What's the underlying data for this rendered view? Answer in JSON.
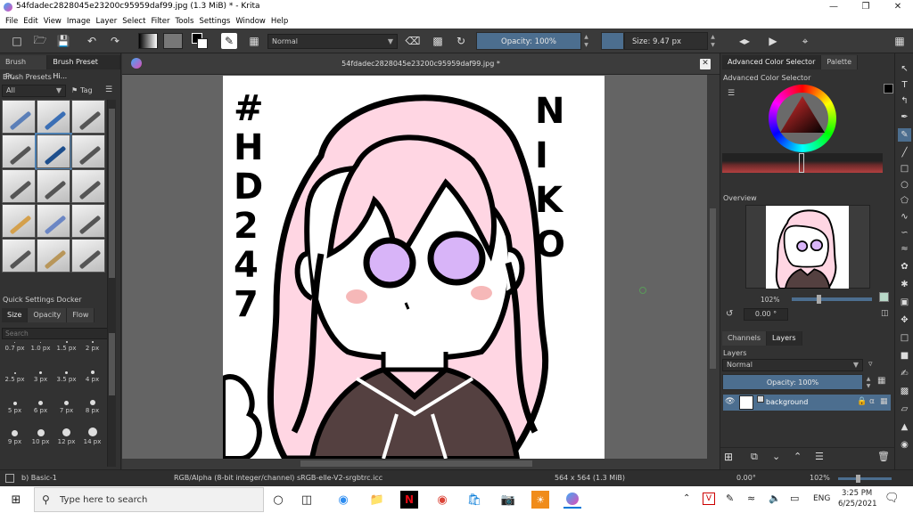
{
  "window": {
    "title": "54fdadec2828045e23200c95959daf99.jpg (1.3 MiB)  * - Krita"
  },
  "menu": [
    "File",
    "Edit",
    "View",
    "Image",
    "Layer",
    "Select",
    "Filter",
    "Tools",
    "Settings",
    "Window",
    "Help"
  ],
  "toolbar": {
    "blend_mode": "Normal",
    "opacity_label": "Opacity: 100%",
    "size_label": "Size: 9.47 px"
  },
  "left_panel": {
    "tab1": "Brush Pr...",
    "tab2": "Brush Preset Hi...",
    "brush_presets_title": "Brush Presets",
    "filter_value": "All",
    "tag_label": "Tag",
    "search_placeholder": "Search",
    "quick_settings_title": "Quick Settings Docker",
    "quick_tabs": [
      "Size",
      "Opacity",
      "Flow"
    ],
    "sizes": [
      "0.7 px",
      "1.0 px",
      "1.5 px",
      "2 px",
      "2.5 px",
      "3 px",
      "3.5 px",
      "4 px",
      "5 px",
      "6 px",
      "7 px",
      "8 px",
      "9 px",
      "10 px",
      "12 px",
      "14 px"
    ]
  },
  "document": {
    "tab_title": "54fdadec2828045e23200c95959daf99.jpg *",
    "drawing_text_left": [
      "#",
      "H",
      "D",
      "2",
      "4",
      "7"
    ],
    "drawing_text_right": [
      "N",
      "I",
      "K",
      "O"
    ]
  },
  "right_panel": {
    "tab1": "Advanced Color Selector",
    "tab2": "Palette",
    "color_selector_title": "Advanced Color Selector",
    "overview_title": "Overview",
    "zoom_value": "102%",
    "rotation_value": "0.00 °",
    "tab_channels": "Channels",
    "tab_layers": "Layers",
    "layers_title": "Layers",
    "layer_blend": "Normal",
    "layer_opacity": "Opacity: 100%",
    "layer_name": "background"
  },
  "status": {
    "brush": "b) Basic-1",
    "color_profile": "RGB/Alpha (8-bit integer/channel)  sRGB-elle-V2-srgbtrc.icc",
    "image_size": "564 x 564 (1.3 MiB)",
    "rotation": "0.00°",
    "zoom": "102%"
  },
  "taskbar": {
    "search_placeholder": "Type here to search",
    "language": "ENG",
    "time": "3:25 PM",
    "date": "6/25/2021"
  },
  "colors": {
    "accent": "#4c6e8f",
    "hair_pink": "#ffd6e3",
    "eye_purple": "#d8b4f8"
  }
}
